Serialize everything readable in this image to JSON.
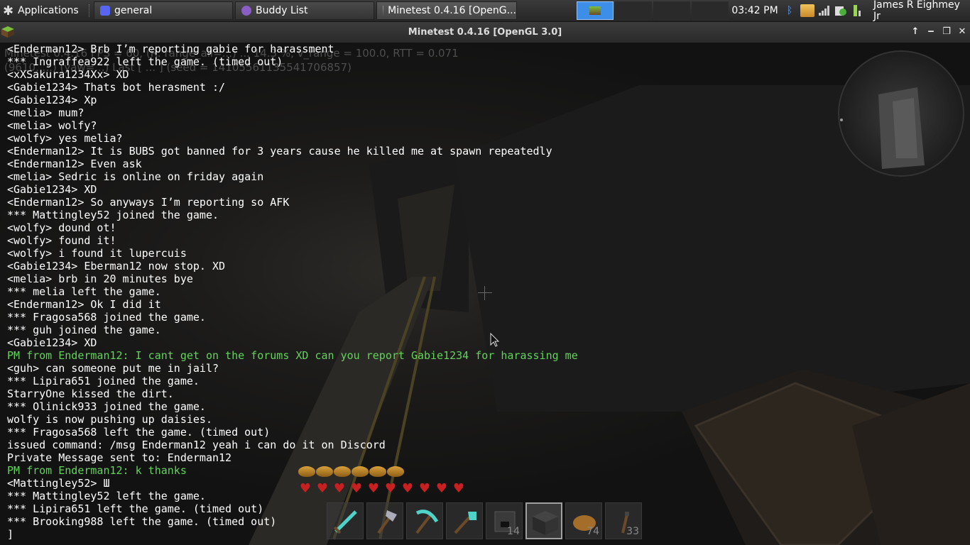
{
  "taskbar": {
    "applications_label": "Applications",
    "tasks": [
      {
        "label": "general",
        "icon": "discord-icon"
      },
      {
        "label": "Buddy List",
        "icon": "pidgin-icon"
      },
      {
        "label": "Minetest 0.4.16 [OpenG...",
        "icon": "minetest-icon"
      }
    ],
    "clock": "03:42 PM",
    "user": "James R Eighmey Jr",
    "tray_icons": [
      "bluetooth-icon",
      "package-updater-icon",
      "network-signal-icon",
      "update-notifier-icon",
      "power-icon"
    ],
    "accent_color": "#3d8ee8"
  },
  "window": {
    "title": "Minetest 0.4.16 [OpenGL 3.0]"
  },
  "debug": {
    "line1": "Minetest 0.4.16 FPS = 60, (R: range_all=...) ... 14.3 %, v_range = 100.0, RTT = 0.071",
    "line2": "(9610, ...) (yaw=...) Last [ ... ] (seed = 14105561135541706857)"
  },
  "chat": [
    {
      "text": "<Enderman12> Brb I’m reporting gabie for harassment",
      "type": "normal"
    },
    {
      "text": "*** Ingraffea922 left the game. (timed out)",
      "type": "normal"
    },
    {
      "text": "<xXSakura1234Xx> XD",
      "type": "normal"
    },
    {
      "text": "<Gabie1234> Thats bot herasment :/",
      "type": "normal"
    },
    {
      "text": "<Gabie1234> Xp",
      "type": "normal"
    },
    {
      "text": "<melia> mum?",
      "type": "normal"
    },
    {
      "text": "<melia> wolfy?",
      "type": "normal"
    },
    {
      "text": "<wolfy> yes melia?",
      "type": "normal"
    },
    {
      "text": "<Enderman12> It is BUBS got banned for 3 years cause he killed me at spawn repeatedly",
      "type": "normal"
    },
    {
      "text": "<Enderman12> Even ask",
      "type": "normal"
    },
    {
      "text": "<melia> Sedric is online on friday again",
      "type": "normal"
    },
    {
      "text": "<Gabie1234> XD",
      "type": "normal"
    },
    {
      "text": "<Enderman12> So anyways I’m reporting so AFK",
      "type": "normal"
    },
    {
      "text": "*** Mattingley52 joined the game.",
      "type": "normal"
    },
    {
      "text": "<wolfy> dound ot!",
      "type": "normal"
    },
    {
      "text": "<wolfy> found it!",
      "type": "normal"
    },
    {
      "text": "<wolfy> i found it lupercuis",
      "type": "normal"
    },
    {
      "text": "<Gabie1234> Eberman12 now stop. XD",
      "type": "normal"
    },
    {
      "text": "<melia> brb in 20 minutes bye",
      "type": "normal"
    },
    {
      "text": "*** melia left the game.",
      "type": "normal"
    },
    {
      "text": "<Enderman12> Ok I did it",
      "type": "normal"
    },
    {
      "text": "*** Fragosa568 joined the game.",
      "type": "normal"
    },
    {
      "text": "*** guh joined the game.",
      "type": "normal"
    },
    {
      "text": "<Gabie1234> XD",
      "type": "normal"
    },
    {
      "text": "PM from Enderman12: I cant get on the forums XD can you report Gabie1234 for harassing me",
      "type": "pm"
    },
    {
      "text": "<guh> can someone put me in jail?",
      "type": "normal"
    },
    {
      "text": "*** Lipira651 joined the game.",
      "type": "normal"
    },
    {
      "text": "StarryOne kissed the dirt.",
      "type": "normal"
    },
    {
      "text": "*** Olinick933 joined the game.",
      "type": "normal"
    },
    {
      "text": "wolfy is now pushing up daisies.",
      "type": "normal"
    },
    {
      "text": "*** Fragosa568 left the game. (timed out)",
      "type": "normal"
    },
    {
      "text": "issued command: /msg Enderman12 yeah i can do it on Discord",
      "type": "normal"
    },
    {
      "text": "Private Message sent to: Enderman12",
      "type": "normal"
    },
    {
      "text": "PM from Enderman12: k thanks",
      "type": "pm"
    },
    {
      "text": "<Mattingley52> Ш",
      "type": "normal"
    },
    {
      "text": "*** Mattingley52 left the game.",
      "type": "normal"
    },
    {
      "text": "*** Lipira651 left the game. (timed out)",
      "type": "normal"
    },
    {
      "text": "*** Brooking988 left the game. (timed out)",
      "type": "normal"
    },
    {
      "text": "]",
      "type": "normal"
    }
  ],
  "hud": {
    "hunger_level": 1.0,
    "health_hearts": 10,
    "hotbar": [
      {
        "item": "diamond-sword-icon",
        "count": ""
      },
      {
        "item": "steel-axe-icon",
        "count": ""
      },
      {
        "item": "diamond-pickaxe-icon",
        "count": ""
      },
      {
        "item": "diamond-shovel-icon",
        "count": ""
      },
      {
        "item": "furnace-block-icon",
        "count": "14"
      },
      {
        "item": "chest-block-icon",
        "count": "",
        "selected": true
      },
      {
        "item": "bread-icon",
        "count": "74"
      },
      {
        "item": "torch-icon",
        "count": "33"
      }
    ]
  }
}
